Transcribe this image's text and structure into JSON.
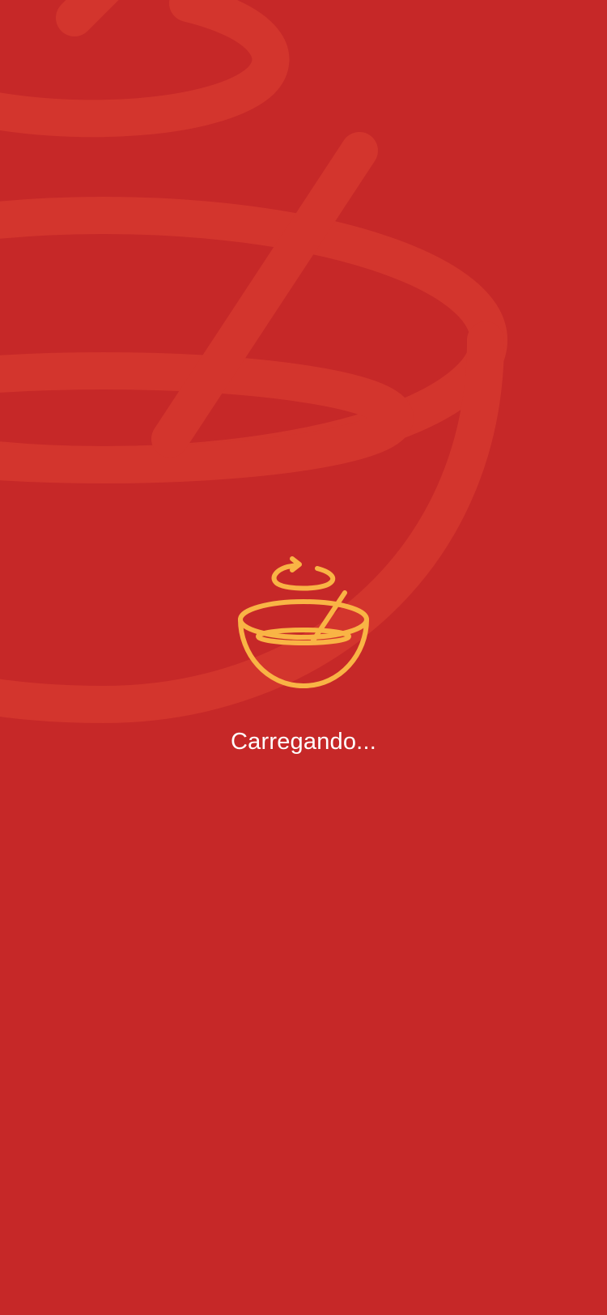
{
  "theme": {
    "background": "#C62828",
    "watermark_color": "#D3352D",
    "accent": "#F9B445",
    "text_color": "#FFFFFF"
  },
  "background": {
    "icon": "mixing-bowl-icon"
  },
  "loader": {
    "icon": "mixing-bowl-icon",
    "text": "Carregando..."
  }
}
